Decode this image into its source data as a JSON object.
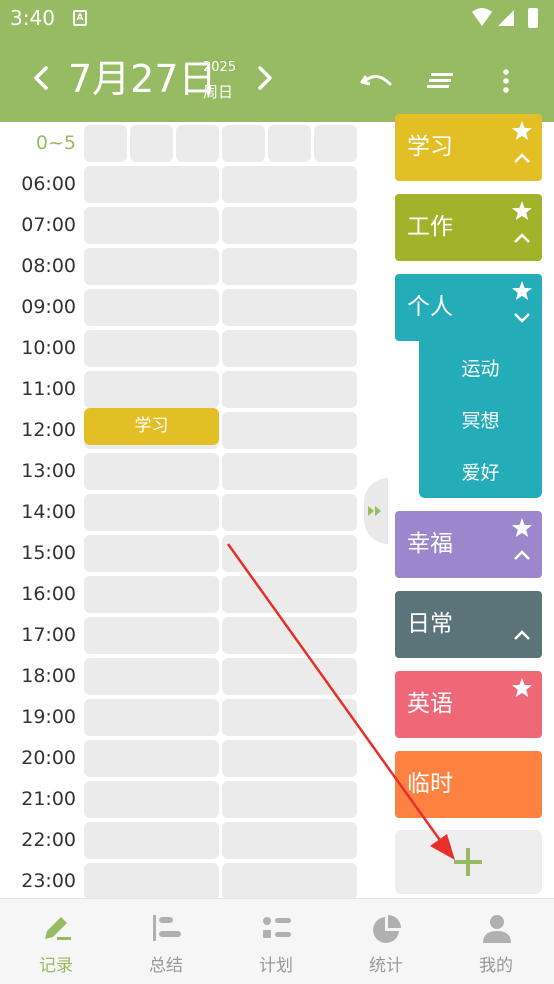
{
  "status_bar": {
    "time": "3:40",
    "sim_label": "A"
  },
  "header": {
    "date": "7月27日",
    "year": "2025",
    "weekday": "周日"
  },
  "time_labels": [
    "0~5",
    "06:00",
    "07:00",
    "08:00",
    "09:00",
    "10:00",
    "11:00",
    "12:00",
    "13:00",
    "14:00",
    "15:00",
    "16:00",
    "17:00",
    "18:00",
    "19:00",
    "20:00",
    "21:00",
    "22:00",
    "23:00"
  ],
  "events": [
    {
      "label": "学习",
      "time": "12:00",
      "color": "#e1bf25"
    }
  ],
  "categories": [
    {
      "label": "学习",
      "color": "#e1bf25",
      "starred": true,
      "chevron": "up"
    },
    {
      "label": "工作",
      "color": "#a2b22a",
      "starred": true,
      "chevron": "up"
    },
    {
      "label": "个人",
      "color": "#24adb9",
      "starred": true,
      "chevron": "down",
      "children": [
        "运动",
        "冥想",
        "爱好"
      ]
    },
    {
      "label": "幸福",
      "color": "#9c87cc",
      "starred": true,
      "chevron": "up"
    },
    {
      "label": "日常",
      "color": "#5b7479",
      "starred": false,
      "chevron": "up"
    },
    {
      "label": "英语",
      "color": "#ef6878",
      "starred": true,
      "chevron": "none"
    },
    {
      "label": "临时",
      "color": "#fd8140",
      "starred": false,
      "chevron": "none"
    }
  ],
  "add_category_icon": "plus-icon",
  "bottom_nav": [
    {
      "label": "记录",
      "icon": "pencil-icon",
      "active": true
    },
    {
      "label": "总结",
      "icon": "summary-list-icon",
      "active": false
    },
    {
      "label": "计划",
      "icon": "plan-list-icon",
      "active": false
    },
    {
      "label": "统计",
      "icon": "pie-chart-icon",
      "active": false
    },
    {
      "label": "我的",
      "icon": "person-icon",
      "active": false
    }
  ],
  "colors": {
    "primary": "#97bb63",
    "cell": "#ebebeb",
    "annotation_arrow": "#e8302a"
  }
}
